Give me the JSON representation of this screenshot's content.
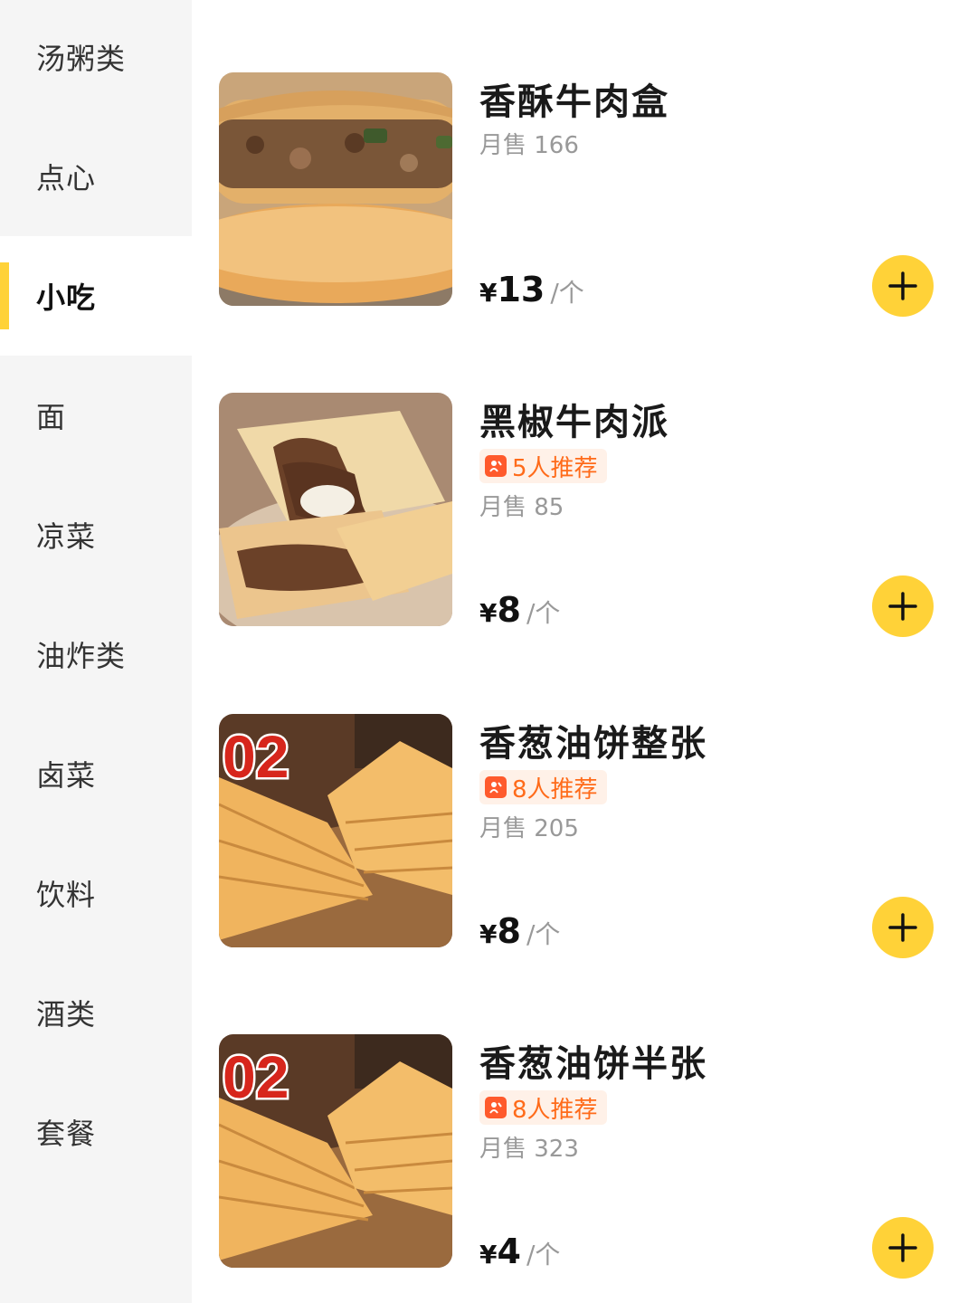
{
  "sidebar": {
    "categories": [
      {
        "label": "汤粥类"
      },
      {
        "label": "点心"
      },
      {
        "label": "小吃"
      },
      {
        "label": "面"
      },
      {
        "label": "凉菜"
      },
      {
        "label": "油炸类"
      },
      {
        "label": "卤菜"
      },
      {
        "label": "饮料"
      },
      {
        "label": "酒类"
      },
      {
        "label": "套餐"
      }
    ],
    "active_index": 2
  },
  "products": [
    {
      "name": "香酥牛肉盒",
      "recommend": "",
      "sales": "月售 166",
      "currency": "¥",
      "price": "13",
      "unit": "/个"
    },
    {
      "name": "黑椒牛肉派",
      "recommend": "5人推荐",
      "sales": "月售 85",
      "currency": "¥",
      "price": "8",
      "unit": "/个"
    },
    {
      "name": "香葱油饼整张",
      "recommend": "8人推荐",
      "sales": "月售 205",
      "currency": "¥",
      "price": "8",
      "unit": "/个",
      "image_text": "02"
    },
    {
      "name": "香葱油饼半张",
      "recommend": "8人推荐",
      "sales": "月售 323",
      "currency": "¥",
      "price": "4",
      "unit": "/个",
      "image_text": "02"
    }
  ],
  "colors": {
    "accent": "#ffd238",
    "badge_text": "#ff6b1a",
    "badge_bg": "#fff1e8",
    "sidebar_bg": "#f5f5f5"
  },
  "icons": {
    "add": "plus-icon",
    "recommend": "recommend-icon"
  }
}
